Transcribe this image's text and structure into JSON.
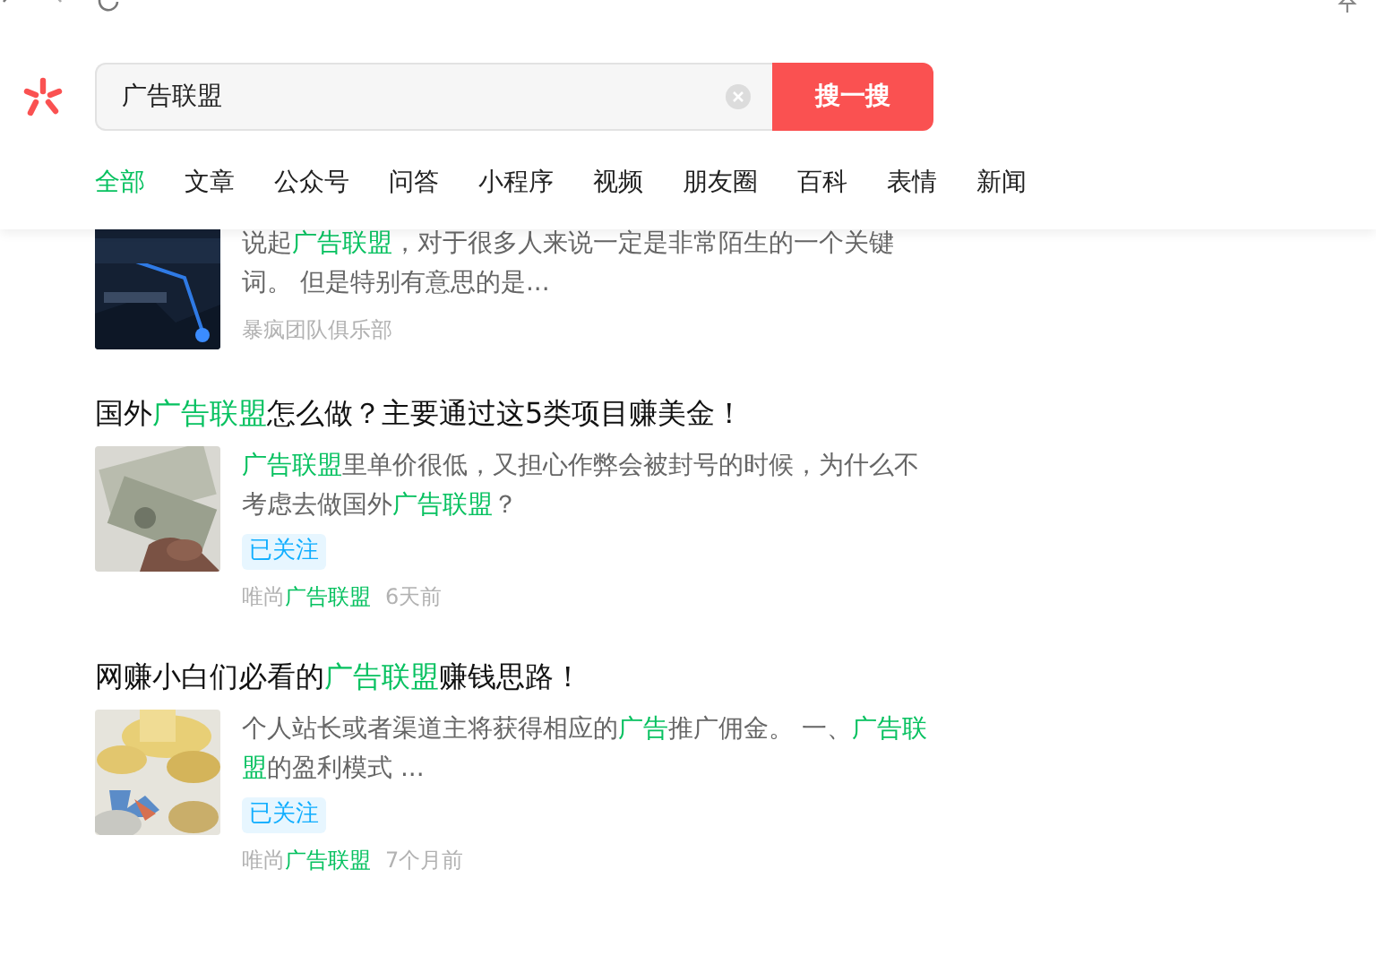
{
  "search": {
    "value": "广告联盟",
    "button": "搜一搜"
  },
  "tabs": [
    {
      "label": "全部",
      "selected": true
    },
    {
      "label": "文章",
      "selected": false
    },
    {
      "label": "公众号",
      "selected": false
    },
    {
      "label": "问答",
      "selected": false
    },
    {
      "label": "小程序",
      "selected": false
    },
    {
      "label": "视频",
      "selected": false
    },
    {
      "label": "朋友圈",
      "selected": false
    },
    {
      "label": "百科",
      "selected": false
    },
    {
      "label": "表情",
      "selected": false
    },
    {
      "label": "新闻",
      "selected": false
    }
  ],
  "results": [
    {
      "snippet": [
        {
          "text": "说起",
          "highlight": false
        },
        {
          "text": "广告联盟",
          "highlight": true
        },
        {
          "text": "，对于很多人来说一定是非常陌生的一个关键词。 但是特别有意思的是...",
          "highlight": false
        }
      ],
      "source": [
        {
          "text": "暴疯团队俱乐部",
          "highlight": false
        }
      ]
    },
    {
      "title": [
        {
          "text": "国外",
          "highlight": false
        },
        {
          "text": "广告联盟",
          "highlight": true
        },
        {
          "text": "怎么做？主要通过这5类项目赚美金！",
          "highlight": false
        }
      ],
      "snippet": [
        {
          "text": "广告联盟",
          "highlight": true
        },
        {
          "text": "里单价很低，又担心作弊会被封号的时候，为什么不考虑去做国外",
          "highlight": false
        },
        {
          "text": "广告联盟",
          "highlight": true
        },
        {
          "text": "？",
          "highlight": false
        }
      ],
      "tag": "已关注",
      "source": [
        {
          "text": "唯尚",
          "highlight": false
        },
        {
          "text": "广告联盟",
          "highlight": true
        }
      ],
      "time": "6天前"
    },
    {
      "title": [
        {
          "text": "网赚小白们必看的",
          "highlight": false
        },
        {
          "text": "广告联盟",
          "highlight": true
        },
        {
          "text": "赚钱思路！",
          "highlight": false
        }
      ],
      "snippet": [
        {
          "text": "个人站长或者渠道主将获得相应的",
          "highlight": false
        },
        {
          "text": "广告",
          "highlight": true
        },
        {
          "text": "推广佣金。 一、",
          "highlight": false
        },
        {
          "text": "广告联盟",
          "highlight": true
        },
        {
          "text": "的盈利模式 ...",
          "highlight": false
        }
      ],
      "tag": "已关注",
      "source": [
        {
          "text": "唯尚",
          "highlight": false
        },
        {
          "text": "广告联盟",
          "highlight": true
        }
      ],
      "time": "7个月前"
    }
  ]
}
